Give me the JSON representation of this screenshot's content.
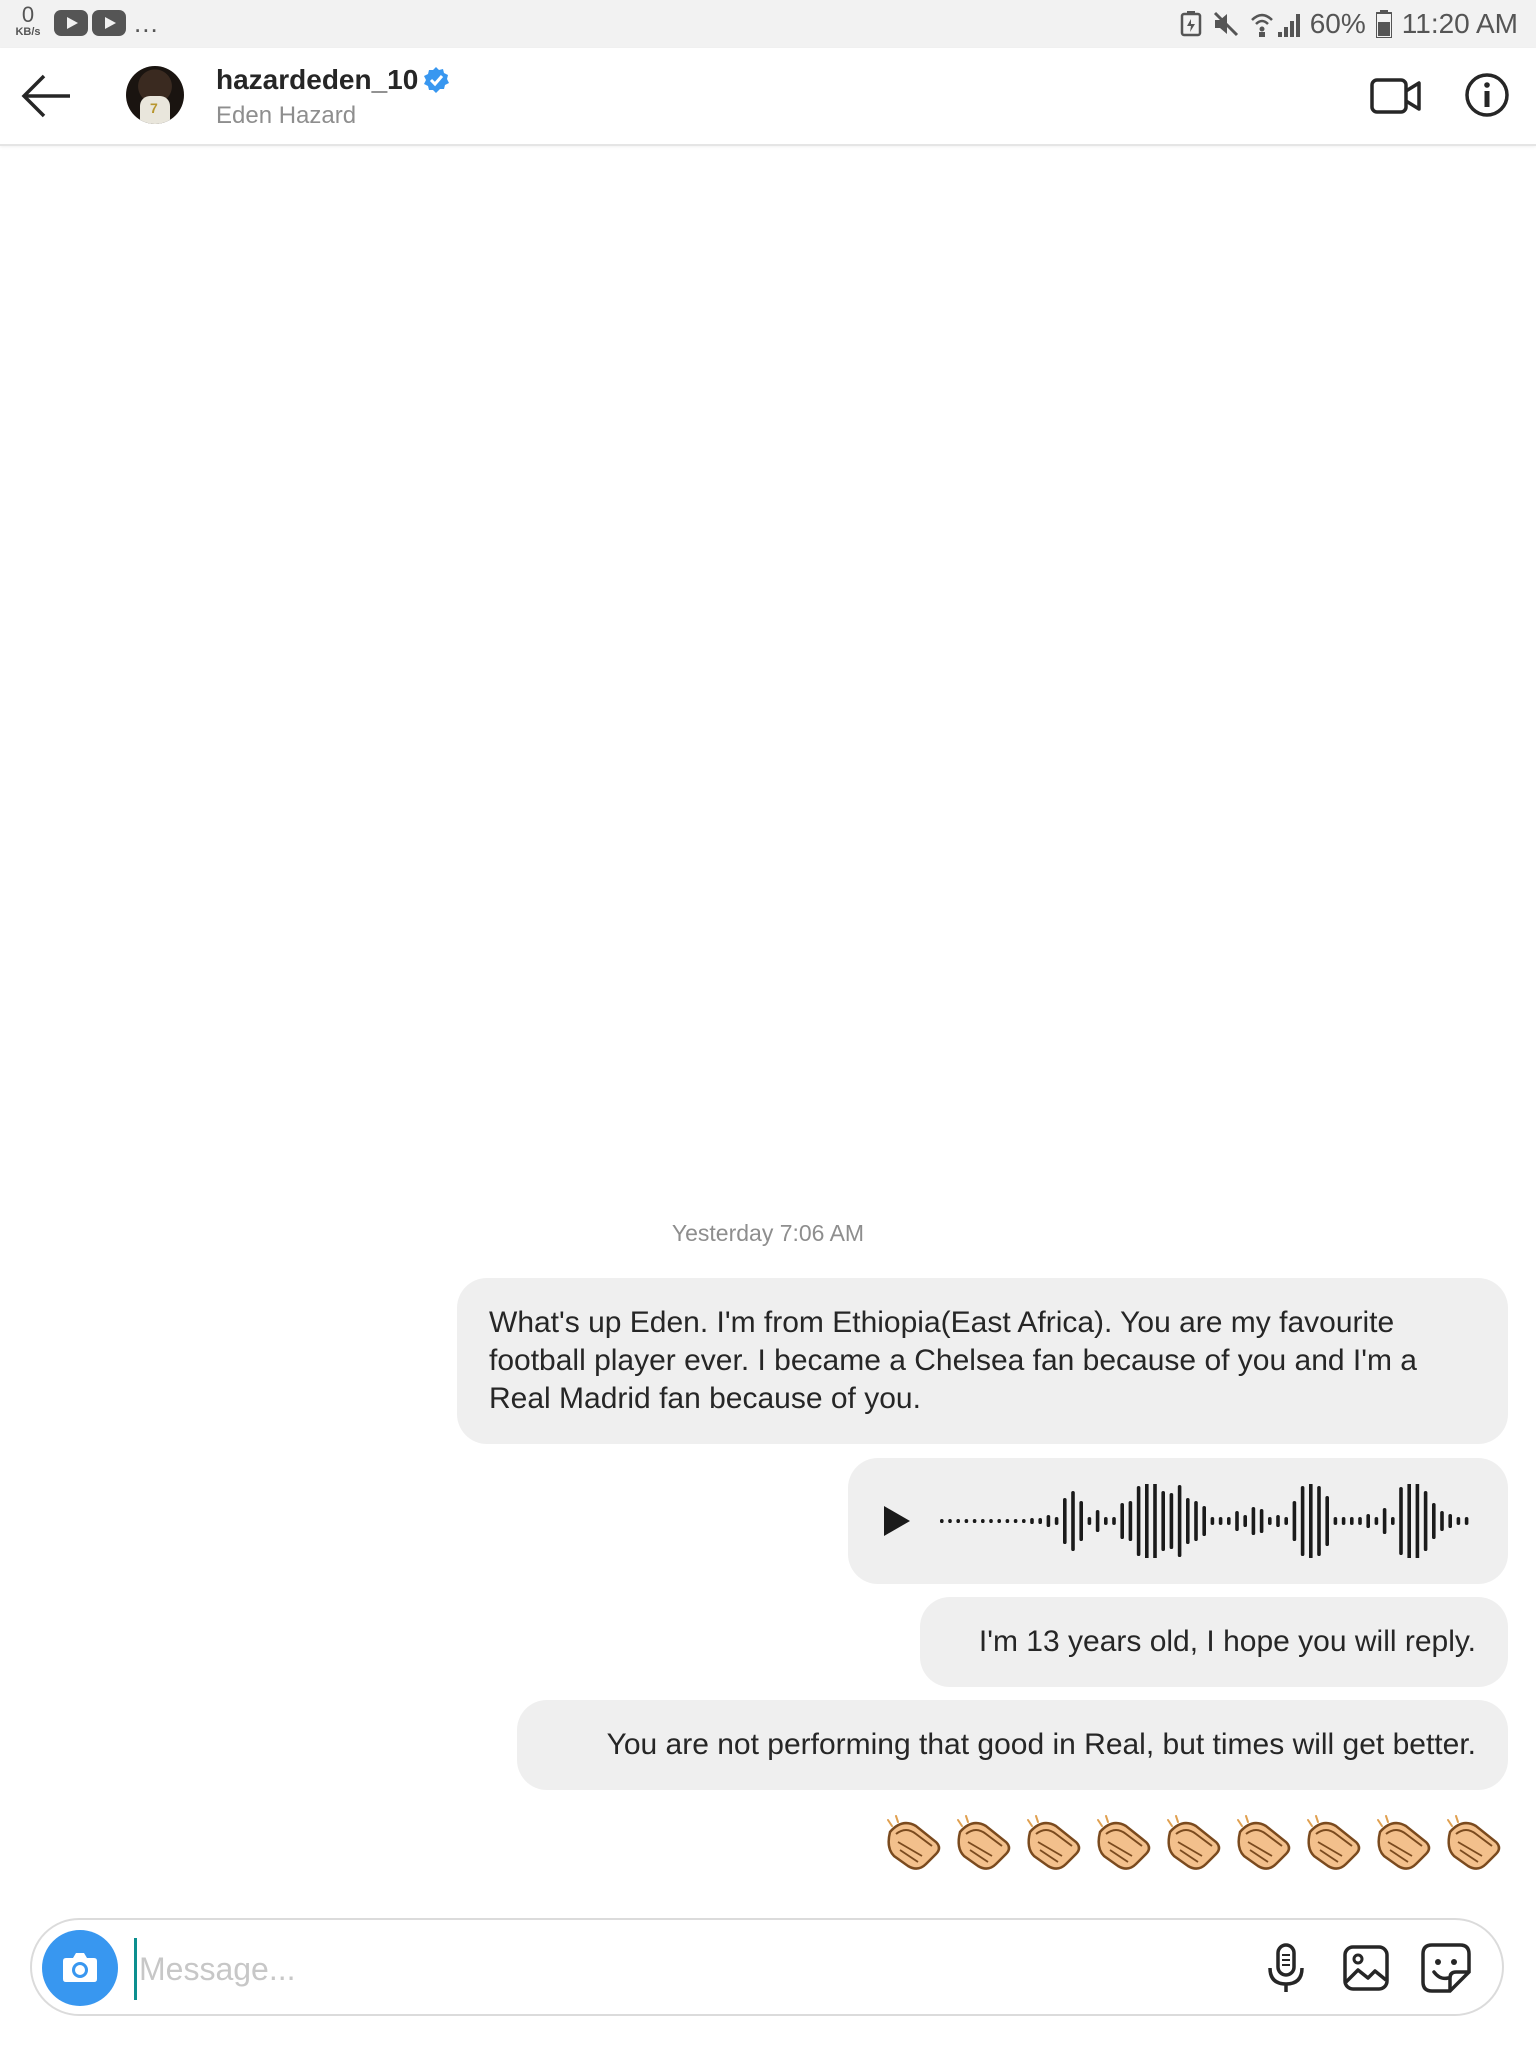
{
  "status_bar": {
    "net_speed_value": "0",
    "net_speed_unit": "KB/s",
    "more_indicator": "...",
    "battery_percent": "60%",
    "time": "11:20 AM"
  },
  "header": {
    "username": "hazardeden_10",
    "full_name": "Eden Hazard",
    "verified": true
  },
  "conversation": {
    "timestamp": "Yesterday 7:06 AM",
    "messages": [
      {
        "type": "text",
        "text": "What's up Eden. I'm from Ethiopia(East Africa). You are my favourite football player ever. I became a Chelsea fan because of you and I'm a Real Madrid fan because of you."
      },
      {
        "type": "voice"
      },
      {
        "type": "text",
        "text": "I'm 13 years old, I hope you will reply."
      },
      {
        "type": "text",
        "text": "You are not performing that good in Real, but times will get better."
      },
      {
        "type": "emoji",
        "emoji_name": "clapping-hands",
        "count": 9
      }
    ]
  },
  "composer": {
    "placeholder": "Message..."
  },
  "colors": {
    "accent_blue": "#3897f0",
    "bubble_gray": "#efefef",
    "text_dark": "#262626",
    "text_muted": "#8e8e8e"
  }
}
